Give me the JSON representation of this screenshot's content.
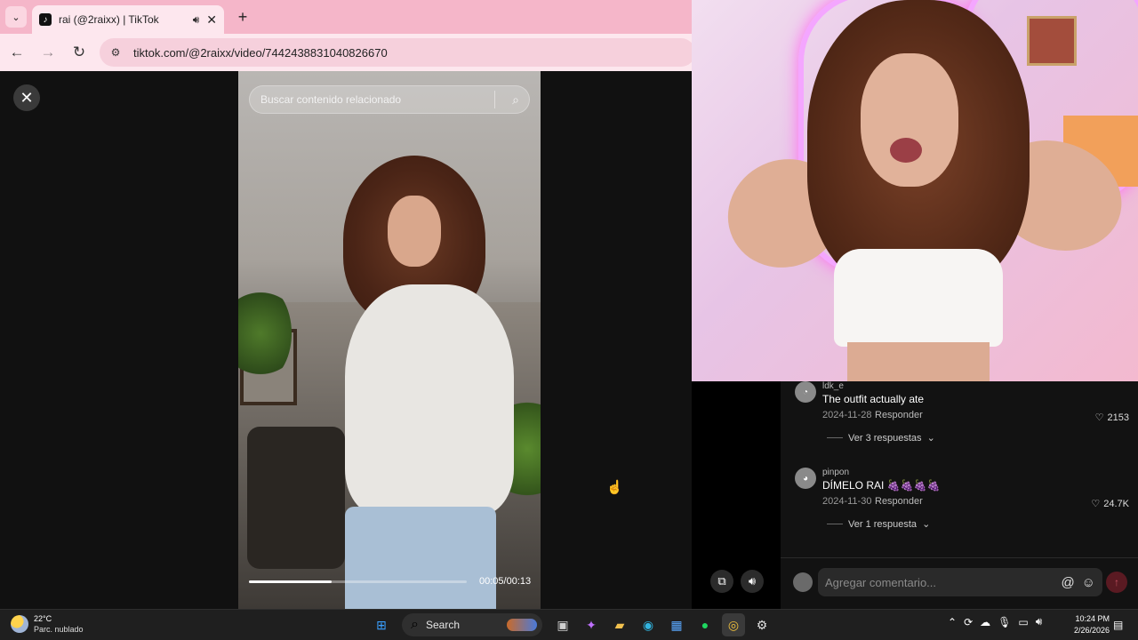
{
  "browser": {
    "tab_title": "rai (@2raixx) | TikTok",
    "tab_audio_icon": "speaker-icon",
    "url_domain": "tiktok.com",
    "url_path": "/@2raixx/video/7442438831040826670"
  },
  "video": {
    "search_placeholder": "Buscar contenido relacionado",
    "progress_fraction": 0.38,
    "time": "00:05/00:13"
  },
  "comments": [
    {
      "user": "ldk_e",
      "text": "The outfit actually ate",
      "date": "2024-11-28",
      "reply_label": "Responder",
      "likes": "2153",
      "more": "Ver 3 respuestas"
    },
    {
      "user": "pinpon",
      "text": "DÍMELO RAI 🍇🍇🍇🍇",
      "date": "2024-11-30",
      "reply_label": "Responder",
      "likes": "24.7K",
      "more": "Ver 1 respuesta"
    }
  ],
  "compose": {
    "placeholder": "Agregar comentario..."
  },
  "taskbar": {
    "temperature": "22°C",
    "weather": "Parc. nublado",
    "search_label": "Search",
    "time": "10:24 PM",
    "date": "2/26/2026"
  }
}
